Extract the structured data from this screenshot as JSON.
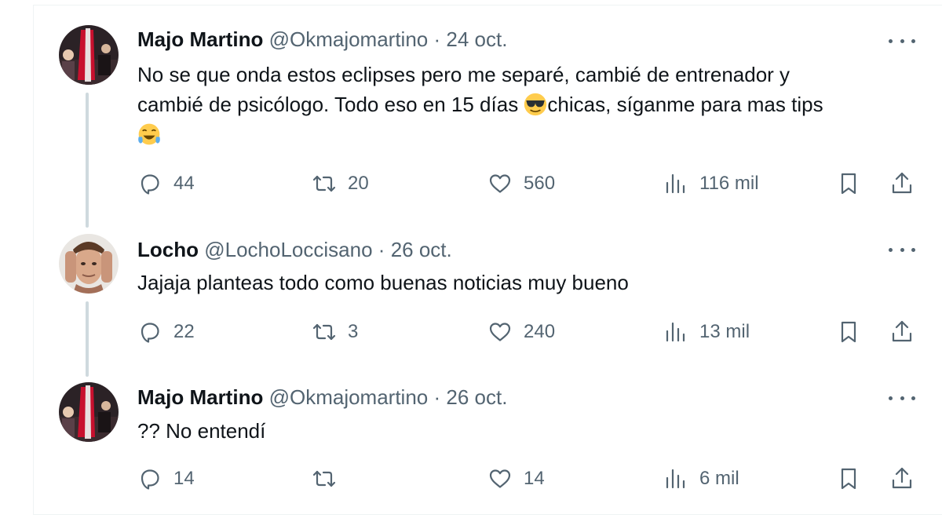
{
  "tweets": [
    {
      "author_name": "Majo Martino",
      "handle": "@Okmajomartino",
      "separator": "·",
      "date": "24 oct.",
      "text_line1": "No se que onda estos eclipses pero me separé, cambié de entrenador y",
      "text_line2a": "cambié de psicólogo. Todo eso en 15 días ",
      "text_line2b": "chicas, síganme para mas tips",
      "emojis": [
        "sunglasses-emoji",
        "tears-of-joy-emoji"
      ],
      "replies": "44",
      "retweets": "20",
      "likes": "560",
      "views": "116 mil"
    },
    {
      "author_name": "Locho",
      "handle": "@LochoLoccisano",
      "separator": "·",
      "date": "26 oct.",
      "text": "Jajaja planteas todo como buenas noticias muy bueno",
      "replies": "22",
      "retweets": "3",
      "likes": "240",
      "views": "13 mil"
    },
    {
      "author_name": "Majo Martino",
      "handle": "@Okmajomartino",
      "separator": "·",
      "date": "26 oct.",
      "text": "?? No entendí",
      "replies": "14",
      "retweets": "",
      "likes": "14",
      "views": "6 mil"
    }
  ],
  "colors": {
    "text": "#0f1419",
    "secondary": "#536471",
    "thread_line": "#cfd9de",
    "border": "#eff3f4"
  },
  "icons": [
    "reply-icon",
    "retweet-icon",
    "like-icon",
    "views-icon",
    "bookmark-icon",
    "share-icon",
    "more-icon"
  ]
}
